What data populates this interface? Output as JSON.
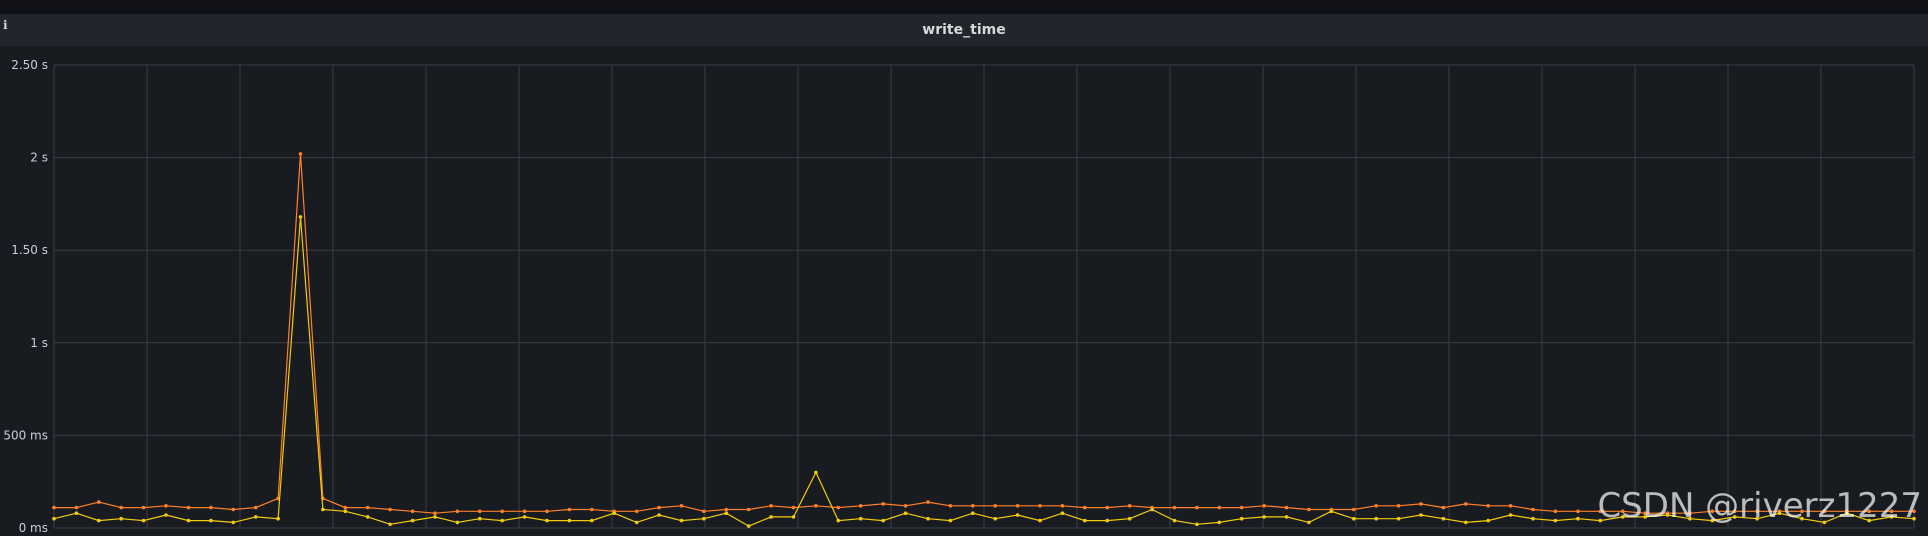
{
  "panel": {
    "title": "write_time",
    "info_icon": "info-icon"
  },
  "watermark": "CSDN @riverz1227",
  "chart_data": {
    "type": "line",
    "title": "write_time",
    "xlabel": "",
    "ylabel": "",
    "ylim": [
      0,
      2.5
    ],
    "yticks": [
      {
        "value": 0,
        "label": "0 ms"
      },
      {
        "value": 0.5,
        "label": "500 ms"
      },
      {
        "value": 1,
        "label": "1 s"
      },
      {
        "value": 1.5,
        "label": "1.50 s"
      },
      {
        "value": 2,
        "label": "2 s"
      },
      {
        "value": 2.5,
        "label": "2.50 s"
      }
    ],
    "x_points": 84,
    "grid": true,
    "series": [
      {
        "color": "#ff7f2a",
        "values": [
          0.11,
          0.11,
          0.14,
          0.11,
          0.11,
          0.12,
          0.11,
          0.11,
          0.1,
          0.11,
          0.16,
          2.02,
          0.16,
          0.11,
          0.11,
          0.1,
          0.09,
          0.08,
          0.09,
          0.09,
          0.09,
          0.09,
          0.09,
          0.1,
          0.1,
          0.09,
          0.09,
          0.11,
          0.12,
          0.09,
          0.1,
          0.1,
          0.12,
          0.11,
          0.12,
          0.11,
          0.12,
          0.13,
          0.12,
          0.14,
          0.12,
          0.12,
          0.12,
          0.12,
          0.12,
          0.12,
          0.11,
          0.11,
          0.12,
          0.11,
          0.11,
          0.11,
          0.11,
          0.11,
          0.12,
          0.11,
          0.1,
          0.1,
          0.1,
          0.12,
          0.12,
          0.13,
          0.11,
          0.13,
          0.12,
          0.12,
          0.1,
          0.09,
          0.09,
          0.09,
          0.09,
          0.08,
          0.08,
          0.08,
          0.09,
          0.09,
          0.09,
          0.09,
          0.09,
          0.09,
          0.09,
          0.09,
          0.09,
          0.09
        ]
      },
      {
        "color": "#f2cc0c",
        "values": [
          0.05,
          0.08,
          0.04,
          0.05,
          0.04,
          0.07,
          0.04,
          0.04,
          0.03,
          0.06,
          0.05,
          1.68,
          0.1,
          0.09,
          0.06,
          0.02,
          0.04,
          0.06,
          0.03,
          0.05,
          0.04,
          0.06,
          0.04,
          0.04,
          0.04,
          0.08,
          0.03,
          0.07,
          0.04,
          0.05,
          0.08,
          0.01,
          0.06,
          0.06,
          0.3,
          0.04,
          0.05,
          0.04,
          0.08,
          0.05,
          0.04,
          0.08,
          0.05,
          0.07,
          0.04,
          0.08,
          0.04,
          0.04,
          0.05,
          0.1,
          0.04,
          0.02,
          0.03,
          0.05,
          0.06,
          0.06,
          0.03,
          0.09,
          0.05,
          0.05,
          0.05,
          0.07,
          0.05,
          0.03,
          0.04,
          0.07,
          0.05,
          0.04,
          0.05,
          0.04,
          0.06,
          0.06,
          0.07,
          0.05,
          0.04,
          0.06,
          0.05,
          0.08,
          0.05,
          0.03,
          0.08,
          0.04,
          0.06,
          0.05
        ]
      }
    ]
  }
}
